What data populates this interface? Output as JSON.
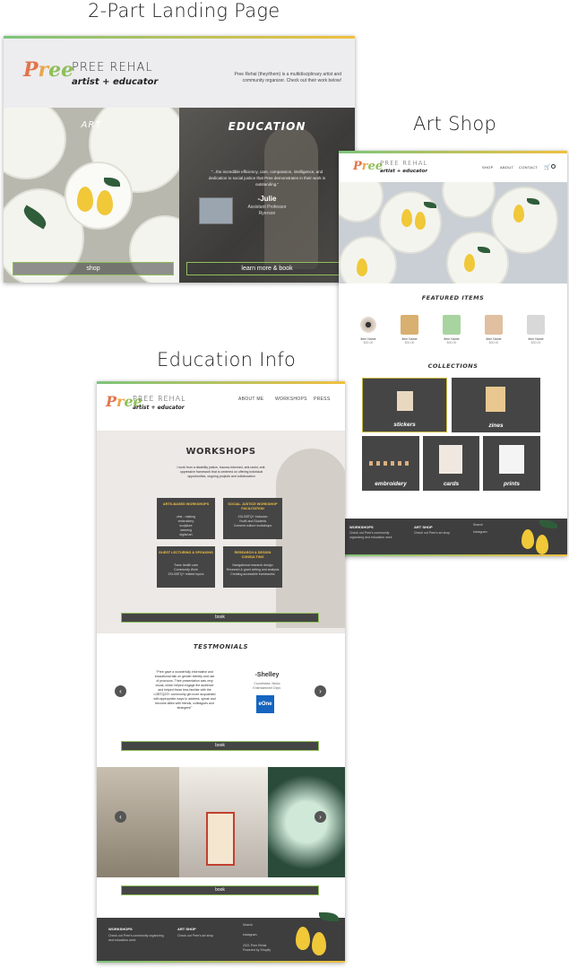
{
  "headings": {
    "landing": "2-Part Landing Page",
    "shop": "Art Shop",
    "education": "Education Info"
  },
  "brand": {
    "name": "PREE REHAL",
    "tagline": "artist + educator",
    "logo_text": [
      "P",
      "r",
      "ee"
    ]
  },
  "landing": {
    "intro": "Pree Rehal (they/them) is a multidisciplinary artist and community organizer. Check out their work below!",
    "art_title": "ART",
    "edu_title": "EDUCATION",
    "quote": "\"...the incredible efficiency, care, compassion, intelligence, and dedication to social justice that Pree demonstrates in their work is outstanding.\"",
    "quote_author": "-Julie",
    "quote_role": "Assistant Professor",
    "quote_org": "Ryerson",
    "shop_button": "shop",
    "learn_button": "learn more & book"
  },
  "shop": {
    "nav": [
      "SHOP",
      "ABOUT",
      "CONTACT"
    ],
    "featured_title": "FEATURED ITEMS",
    "featured": [
      {
        "name": "Item Name",
        "price": "$00.00"
      },
      {
        "name": "Item Name",
        "price": "$00.00"
      },
      {
        "name": "Item Name",
        "price": "$00.00"
      },
      {
        "name": "Item Name",
        "price": "$00.00"
      },
      {
        "name": "Item Name",
        "price": "$00.00"
      }
    ],
    "collections_title": "COLLECTIONS",
    "collections": [
      "stickers",
      "zines",
      "embroidery",
      "cards",
      "prints"
    ],
    "footer": {
      "col1_title": "WORKSHOPS",
      "col1_text": "Check out Pree's community organizing and education work",
      "col2_title": "ART SHOP",
      "col2_text": "Check out Pree's art shop",
      "links": [
        "Search",
        "Instagram"
      ]
    }
  },
  "education": {
    "nav": [
      "ABOUT ME",
      "WORKSHOPS",
      "PRESS"
    ],
    "workshops_title": "WORKSHOPS",
    "workshops_intro": "I work from a disability justice, trauma-informed, anti-racist, anti-oppressive framework that is centered on offering individual opportunities, ongoing projects and collaboration",
    "boxes": [
      {
        "title": "ARTS-BASED WORKSHOPS",
        "desc": "zine - making\nembroidery\nsculpture\nweaving\ndigital art"
      },
      {
        "title": "SOCIAL JUSTICE WORKSHOP FACILITATION",
        "desc": "2SLGBTQ+ Inclusion\nYouth and Students\nConsent culture workshops"
      },
      {
        "title": "GUEST LECTURING & SPEAKING",
        "desc": "Trans health care\nCommunity Work\n2SLGBTQ+ related topics"
      },
      {
        "title": "RESEARCH & DESIGN CONSULTING",
        "desc": "Navigational research design\nResearch & grant writing and analysis\nCreating accessible frameworks"
      }
    ],
    "book_label": "book",
    "testimonials_title": "TESTMONIALS",
    "testimonial_quote": "\"Pree gave a wonderfully informative and educational talk on gender identity and use of pronouns. Their presentation was very visual, which helped engage the audience and helped those less familiar with the LGBTQ2S+ community get more acquainted with appropriate ways to address, speak and become allies with friends, colleagues and strangers!\"",
    "testimonial_author": "-Shelley",
    "testimonial_role": "Coordinator, Music\nEntertainment Dept.",
    "testimonial_logo": "eOne",
    "arrow_prev": "‹",
    "arrow_next": "›",
    "footer": {
      "col1_title": "WORKSHOPS",
      "col1_text": "Check out Pree's community organizing and education work",
      "col2_title": "ART SHOP",
      "col2_text": "Check out Pree's art shop",
      "links": [
        "Search",
        "Instagram"
      ],
      "copyright": "2021 Pree Rehal\nPowered by Shopify"
    }
  },
  "colors": {
    "accent_green": "#8fbf5a",
    "accent_yellow": "#f0c040",
    "dark_panel": "#454545",
    "footer_bg": "#3e3e3e"
  }
}
